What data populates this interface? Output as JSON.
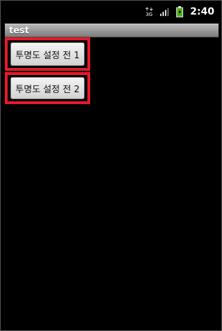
{
  "status_bar": {
    "time": "2:40",
    "icons": [
      "data-3g-icon",
      "signal-strength-icon",
      "battery-charging-icon"
    ],
    "network_label": "3G"
  },
  "app": {
    "title": "test"
  },
  "buttons": [
    {
      "label": "투명도 설정 전 1"
    },
    {
      "label": "투명도 설정 전 2"
    }
  ],
  "colors": {
    "highlight": "#e8192a",
    "title_bar": "#9a9a9a",
    "background": "#000000"
  }
}
